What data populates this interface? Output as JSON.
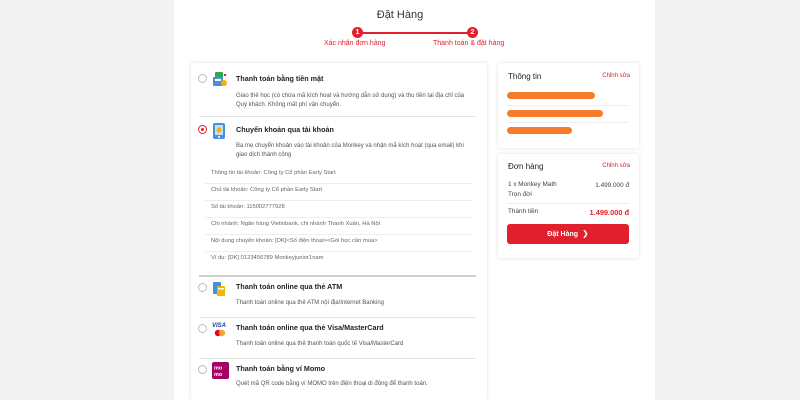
{
  "page": {
    "title": "Đặt Hàng"
  },
  "steps": [
    {
      "number": "1",
      "label": "Xác nhận đơn hàng"
    },
    {
      "number": "2",
      "label": "Thanh toán & đặt hàng"
    }
  ],
  "colors": {
    "accent": "#e0202c",
    "redacted_bar": "#f47c2a"
  },
  "payment": {
    "options": [
      {
        "icon": "cash-icon",
        "title": "Thanh toán bằng tiền mặt",
        "description": "Giao thẻ học (có chứa mã kích hoạt và hướng dẫn sử dụng) và thu tiền tại địa chỉ của Quý khách. Không mất phí vận chuyển."
      },
      {
        "icon": "bank-transfer-icon",
        "title": "Chuyển khoản qua tài khoản",
        "description": "Ba mẹ chuyển khoản vào tài khoản của Monkey và nhận mã kích hoạt (qua email) khi giao dịch thành công",
        "selected": true
      },
      {
        "icon": "atm-card-icon",
        "title": "Thanh toán online qua thẻ ATM",
        "description": "Thanh toán online qua thẻ ATM nội địa/Internet Banking"
      },
      {
        "icon": "visa-mastercard-icon",
        "title": "Thanh toán online qua thẻ Visa/MasterCard",
        "description": "Thanh toán online qua thẻ thanh toán quốc tế Visa/MasterCard"
      },
      {
        "icon": "momo-icon",
        "title": "Thanh toán bằng ví Momo",
        "description": "Quét mã QR code bằng ví MOMO trên điện thoại di động để thanh toán."
      }
    ],
    "bank_info": [
      "Thông tin tài khoản: Công ty Cổ phần Early Start",
      "Chủ tài khoản: Công ty Cổ phần Early Start",
      "Số tài khoản: 115002777928",
      "Chi nhánh: Ngân hàng Vietinbank, chi nhánh Thanh Xuân, Hà Nội",
      "Nội dung chuyển khoản: [DK]<Số điện thoại><Gói học cần mua>",
      "Ví dụ: [DK] 0123456789 Monkeyjunior1nam"
    ]
  },
  "info_panel": {
    "heading": "Thông tin",
    "edit_label": "Chỉnh sửa",
    "redacted_rows": 3
  },
  "order_panel": {
    "heading": "Đơn hàng",
    "edit_label": "Chỉnh sửa",
    "item_line1": "1 x Monkey Math",
    "item_line2": "Trọn đời",
    "item_price": "1.499.000 đ",
    "total_label": "Thành tiền",
    "total_value": "1.499.000 đ",
    "button_label": "Đặt Hàng",
    "button_icon": "chevron-right-icon"
  }
}
